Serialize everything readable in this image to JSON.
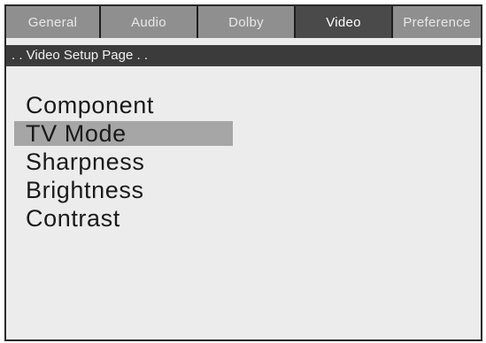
{
  "tabs": [
    {
      "label": "General",
      "active": false
    },
    {
      "label": "Audio",
      "active": false
    },
    {
      "label": "Dolby",
      "active": false
    },
    {
      "label": "Video",
      "active": true
    },
    {
      "label": "Preference",
      "active": false
    }
  ],
  "page_title": ". . Video Setup Page . .",
  "menu": [
    {
      "label": "Component",
      "selected": false
    },
    {
      "label": "TV Mode",
      "selected": true
    },
    {
      "label": "Sharpness",
      "selected": false
    },
    {
      "label": "Brightness",
      "selected": false
    },
    {
      "label": "Contrast",
      "selected": false
    }
  ],
  "colors": {
    "tab_bg": "#8f8f8f",
    "tab_active_bg": "#4a4a4a",
    "page_bar_bg": "#3b3b3b",
    "panel_bg": "#ececec",
    "highlight": "#a6a6a6"
  }
}
